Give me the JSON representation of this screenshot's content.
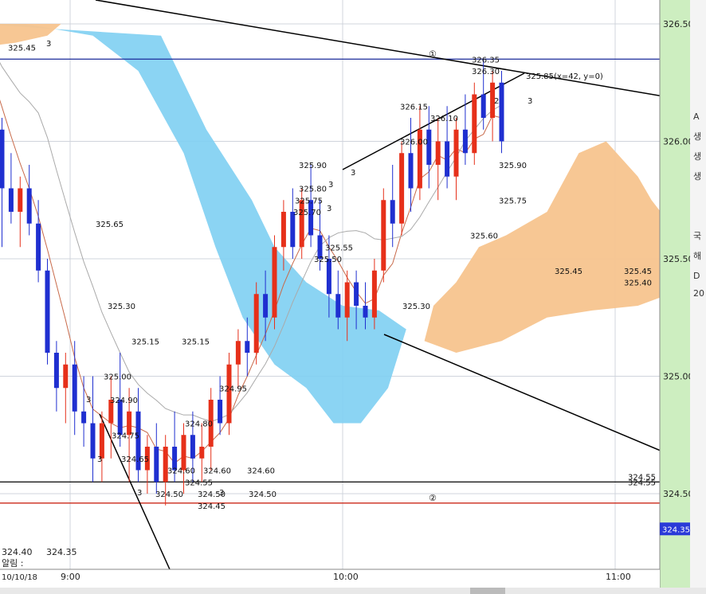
{
  "chart_data": {
    "type": "candlestick",
    "title": "",
    "ylim": [
      324.3,
      326.55
    ],
    "y_ticks": [
      "326.50",
      "326.00",
      "325.50",
      "325.00",
      "324.50",
      "324.35"
    ],
    "x_ticks": [
      "9:00",
      "10:00",
      "11:00"
    ],
    "date_label": "10/10/18",
    "bottom_left_values": [
      "324.40",
      "324.35"
    ],
    "bottom_left_label": "알림 :",
    "right_panel_letters": [
      "A",
      "생",
      "생",
      "생",
      "국",
      "해",
      "D",
      "20"
    ],
    "candles_note": "5-min style bars, red=up, blue=down",
    "candles": [
      {
        "x": "08:35",
        "o": 326.35,
        "h": 326.45,
        "l": 326.2,
        "c": 326.4
      },
      {
        "x": "08:37",
        "o": 326.4,
        "h": 326.48,
        "l": 326.3,
        "c": 326.32
      },
      {
        "x": "08:39",
        "o": 326.32,
        "h": 326.42,
        "l": 326.15,
        "c": 326.38
      },
      {
        "x": "08:41",
        "o": 326.38,
        "h": 326.42,
        "l": 326.1,
        "c": 326.18
      },
      {
        "x": "08:43",
        "o": 326.18,
        "h": 326.25,
        "l": 325.95,
        "c": 326.05
      },
      {
        "x": "08:45",
        "o": 326.05,
        "h": 326.1,
        "l": 325.55,
        "c": 325.8
      },
      {
        "x": "08:47",
        "o": 325.8,
        "h": 325.95,
        "l": 325.65,
        "c": 325.7
      },
      {
        "x": "08:49",
        "o": 325.7,
        "h": 325.85,
        "l": 325.55,
        "c": 325.8
      },
      {
        "x": "08:51",
        "o": 325.8,
        "h": 325.9,
        "l": 325.6,
        "c": 325.65
      },
      {
        "x": "08:53",
        "o": 325.65,
        "h": 325.75,
        "l": 325.4,
        "c": 325.45
      },
      {
        "x": "08:55",
        "o": 325.45,
        "h": 325.5,
        "l": 325.05,
        "c": 325.1
      },
      {
        "x": "08:57",
        "o": 325.1,
        "h": 325.15,
        "l": 324.85,
        "c": 324.95
      },
      {
        "x": "08:59",
        "o": 324.95,
        "h": 325.1,
        "l": 324.8,
        "c": 325.05
      },
      {
        "x": "09:01",
        "o": 325.05,
        "h": 325.15,
        "l": 324.75,
        "c": 324.85
      },
      {
        "x": "09:03",
        "o": 324.85,
        "h": 325.0,
        "l": 324.7,
        "c": 324.8
      },
      {
        "x": "09:05",
        "o": 324.8,
        "h": 325.0,
        "l": 324.55,
        "c": 324.65
      },
      {
        "x": "09:07",
        "o": 324.65,
        "h": 324.85,
        "l": 324.55,
        "c": 324.8
      },
      {
        "x": "09:09",
        "o": 324.8,
        "h": 325.0,
        "l": 324.65,
        "c": 324.9
      },
      {
        "x": "09:11",
        "o": 324.9,
        "h": 325.1,
        "l": 324.7,
        "c": 324.75
      },
      {
        "x": "09:13",
        "o": 324.75,
        "h": 324.95,
        "l": 324.55,
        "c": 324.85
      },
      {
        "x": "09:15",
        "o": 324.85,
        "h": 324.95,
        "l": 324.55,
        "c": 324.6
      },
      {
        "x": "09:17",
        "o": 324.6,
        "h": 324.75,
        "l": 324.5,
        "c": 324.7
      },
      {
        "x": "09:19",
        "o": 324.7,
        "h": 324.8,
        "l": 324.5,
        "c": 324.55
      },
      {
        "x": "09:21",
        "o": 324.55,
        "h": 324.75,
        "l": 324.45,
        "c": 324.7
      },
      {
        "x": "09:23",
        "o": 324.7,
        "h": 324.85,
        "l": 324.55,
        "c": 324.6
      },
      {
        "x": "09:25",
        "o": 324.6,
        "h": 324.8,
        "l": 324.5,
        "c": 324.75
      },
      {
        "x": "09:27",
        "o": 324.75,
        "h": 324.85,
        "l": 324.55,
        "c": 324.65
      },
      {
        "x": "09:29",
        "o": 324.65,
        "h": 324.8,
        "l": 324.55,
        "c": 324.7
      },
      {
        "x": "09:31",
        "o": 324.7,
        "h": 324.95,
        "l": 324.6,
        "c": 324.9
      },
      {
        "x": "09:33",
        "o": 324.9,
        "h": 325.0,
        "l": 324.75,
        "c": 324.8
      },
      {
        "x": "09:35",
        "o": 324.8,
        "h": 325.1,
        "l": 324.75,
        "c": 325.05
      },
      {
        "x": "09:37",
        "o": 325.05,
        "h": 325.2,
        "l": 324.95,
        "c": 325.15
      },
      {
        "x": "09:39",
        "o": 325.15,
        "h": 325.25,
        "l": 325.0,
        "c": 325.1
      },
      {
        "x": "09:41",
        "o": 325.1,
        "h": 325.4,
        "l": 325.05,
        "c": 325.35
      },
      {
        "x": "09:43",
        "o": 325.35,
        "h": 325.45,
        "l": 325.15,
        "c": 325.25
      },
      {
        "x": "09:45",
        "o": 325.25,
        "h": 325.6,
        "l": 325.2,
        "c": 325.55
      },
      {
        "x": "09:47",
        "o": 325.55,
        "h": 325.75,
        "l": 325.45,
        "c": 325.7
      },
      {
        "x": "09:49",
        "o": 325.7,
        "h": 325.8,
        "l": 325.5,
        "c": 325.55
      },
      {
        "x": "09:51",
        "o": 325.55,
        "h": 325.8,
        "l": 325.5,
        "c": 325.75
      },
      {
        "x": "09:53",
        "o": 325.75,
        "h": 325.9,
        "l": 325.55,
        "c": 325.6
      },
      {
        "x": "09:55",
        "o": 325.6,
        "h": 325.75,
        "l": 325.45,
        "c": 325.5
      },
      {
        "x": "09:57",
        "o": 325.5,
        "h": 325.6,
        "l": 325.25,
        "c": 325.35
      },
      {
        "x": "09:59",
        "o": 325.35,
        "h": 325.45,
        "l": 325.2,
        "c": 325.25
      },
      {
        "x": "10:01",
        "o": 325.25,
        "h": 325.45,
        "l": 325.15,
        "c": 325.4
      },
      {
        "x": "10:03",
        "o": 325.4,
        "h": 325.45,
        "l": 325.2,
        "c": 325.3
      },
      {
        "x": "10:05",
        "o": 325.3,
        "h": 325.4,
        "l": 325.2,
        "c": 325.25
      },
      {
        "x": "10:07",
        "o": 325.25,
        "h": 325.5,
        "l": 325.2,
        "c": 325.45
      },
      {
        "x": "10:09",
        "o": 325.45,
        "h": 325.8,
        "l": 325.4,
        "c": 325.75
      },
      {
        "x": "10:11",
        "o": 325.75,
        "h": 325.9,
        "l": 325.55,
        "c": 325.65
      },
      {
        "x": "10:13",
        "o": 325.65,
        "h": 326.0,
        "l": 325.6,
        "c": 325.95
      },
      {
        "x": "10:15",
        "o": 325.95,
        "h": 326.1,
        "l": 325.7,
        "c": 325.8
      },
      {
        "x": "10:17",
        "o": 325.8,
        "h": 326.15,
        "l": 325.75,
        "c": 326.05
      },
      {
        "x": "10:19",
        "o": 326.05,
        "h": 326.15,
        "l": 325.8,
        "c": 325.9
      },
      {
        "x": "10:21",
        "o": 325.9,
        "h": 326.1,
        "l": 325.75,
        "c": 326.0
      },
      {
        "x": "10:23",
        "o": 326.0,
        "h": 326.15,
        "l": 325.8,
        "c": 325.85
      },
      {
        "x": "10:25",
        "o": 325.85,
        "h": 326.1,
        "l": 325.75,
        "c": 326.05
      },
      {
        "x": "10:27",
        "o": 326.05,
        "h": 326.2,
        "l": 325.9,
        "c": 325.95
      },
      {
        "x": "10:29",
        "o": 325.95,
        "h": 326.25,
        "l": 325.9,
        "c": 326.2
      },
      {
        "x": "10:31",
        "o": 326.2,
        "h": 326.35,
        "l": 326.05,
        "c": 326.1
      },
      {
        "x": "10:33",
        "o": 326.1,
        "h": 326.3,
        "l": 326.0,
        "c": 326.25
      },
      {
        "x": "10:35",
        "o": 326.25,
        "h": 326.3,
        "l": 325.95,
        "c": 326.0
      }
    ],
    "ichimoku_cloud_note": "blue cloud (bearish) left, orange cloud (bullish) right",
    "price_labels": [
      {
        "text": "325.45",
        "price": 326.4
      },
      {
        "text": "325.65",
        "price": 325.65
      },
      {
        "text": "325.30",
        "price": 325.3
      },
      {
        "text": "325.15",
        "price": 325.15
      },
      {
        "text": "325.15",
        "price": 325.15
      },
      {
        "text": "325.00",
        "price": 325.0
      },
      {
        "text": "324.90",
        "price": 324.9
      },
      {
        "text": "324.95",
        "price": 324.95
      },
      {
        "text": "324.80",
        "price": 324.8
      },
      {
        "text": "324.75",
        "price": 324.75
      },
      {
        "text": "324.65",
        "price": 324.65
      },
      {
        "text": "324.60",
        "price": 324.6
      },
      {
        "text": "324.60",
        "price": 324.6
      },
      {
        "text": "324.60",
        "price": 324.6
      },
      {
        "text": "324.55",
        "price": 324.55
      },
      {
        "text": "324.50",
        "price": 324.5
      },
      {
        "text": "324.50",
        "price": 324.5
      },
      {
        "text": "324.50",
        "price": 324.5
      },
      {
        "text": "324.45",
        "price": 324.45
      },
      {
        "text": "325.90",
        "price": 325.9
      },
      {
        "text": "325.80",
        "price": 325.8
      },
      {
        "text": "325.75",
        "price": 325.75
      },
      {
        "text": "325.70",
        "price": 325.7
      },
      {
        "text": "325.55",
        "price": 325.55
      },
      {
        "text": "325.50",
        "price": 325.5
      },
      {
        "text": "325.30",
        "price": 325.3
      },
      {
        "text": "326.15",
        "price": 326.15
      },
      {
        "text": "326.10",
        "price": 326.1
      },
      {
        "text": "326.00",
        "price": 326.0
      },
      {
        "text": "326.35",
        "price": 326.35
      },
      {
        "text": "325.90",
        "price": 325.9
      },
      {
        "text": "325.75",
        "price": 325.75
      },
      {
        "text": "325.60",
        "price": 325.6
      },
      {
        "text": "325.45",
        "price": 325.45
      },
      {
        "text": "326.30",
        "price": 326.3
      },
      {
        "text": "325.45",
        "price": 325.45
      },
      {
        "text": "325.40",
        "price": 325.4
      },
      {
        "text": "324.55",
        "price": 324.55
      }
    ],
    "horizontal_lines": [
      {
        "price": 326.35,
        "color": "#1a2a9a",
        "marker": "①"
      },
      {
        "price": 324.55,
        "color": "#000000",
        "label": "324.55"
      },
      {
        "price": 324.46,
        "color": "#cc2a1a",
        "marker": "②"
      }
    ],
    "annotation_top": "325.85(x=42, y=0)",
    "pattern_numbers": [
      "3",
      "3",
      "3",
      "3",
      "3",
      "3",
      "3",
      "2",
      "3",
      "3"
    ],
    "colors": {
      "up": "#e6301a",
      "down": "#1f2fd0",
      "cloud_blue": "#7ecff2",
      "cloud_orange": "#f7c48e",
      "axis_panel": "#cdeec0",
      "grid": "#d0d4dc",
      "green_marker": "#22aa22",
      "current_price_bg": "#2a3ad8"
    }
  }
}
